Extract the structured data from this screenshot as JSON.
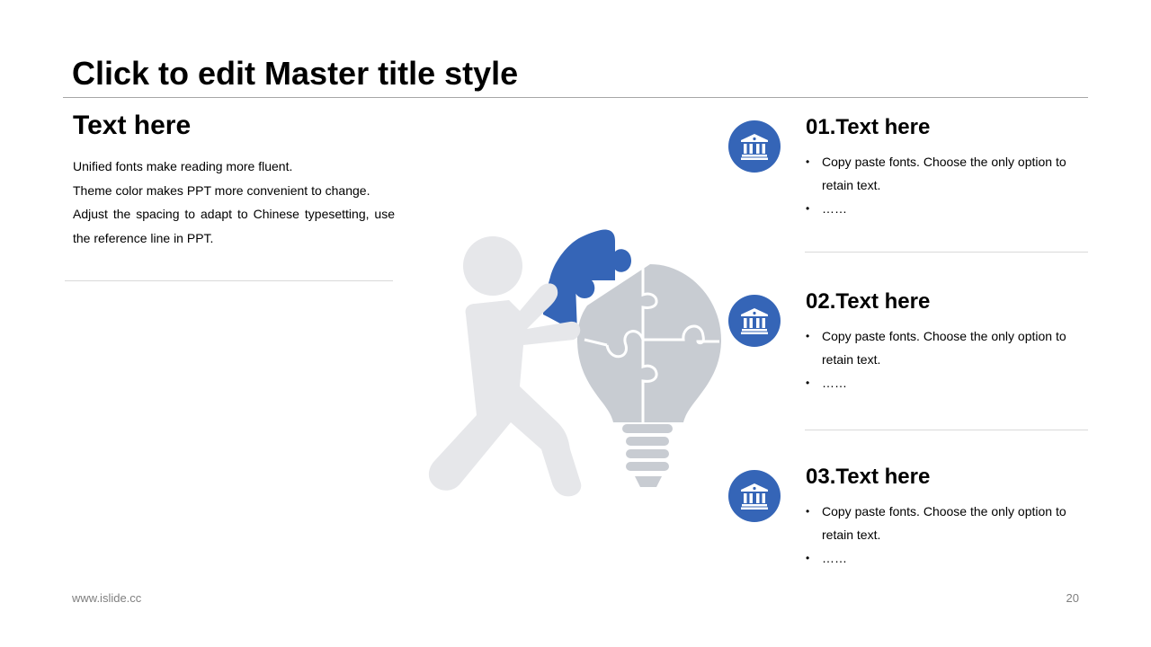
{
  "slide": {
    "title": "Click to edit Master title style"
  },
  "left": {
    "heading": "Text here",
    "lines": [
      "Unified fonts make reading more fluent.",
      "Theme color makes PPT more convenient to change.",
      "Adjust the spacing to adapt to Chinese typesetting, use",
      "the reference line in PPT."
    ]
  },
  "items": [
    {
      "heading": "01.Text here",
      "bullets": [
        "Copy paste fonts. Choose the only option to retain text.",
        "……"
      ],
      "icon": "bank-icon"
    },
    {
      "heading": "02.Text here",
      "bullets": [
        "Copy paste fonts. Choose the only option to retain text.",
        "……"
      ],
      "icon": "bank-icon"
    },
    {
      "heading": "03.Text here",
      "bullets": [
        "Copy paste fonts. Choose the only option to retain text.",
        "……"
      ],
      "icon": "bank-icon"
    }
  ],
  "colors": {
    "accent": "#3565b7",
    "figure_gray": "#e6e7ea",
    "bulb_gray": "#c8ccd2"
  },
  "footer": {
    "website": "www.islide.cc",
    "page_number": "20"
  }
}
